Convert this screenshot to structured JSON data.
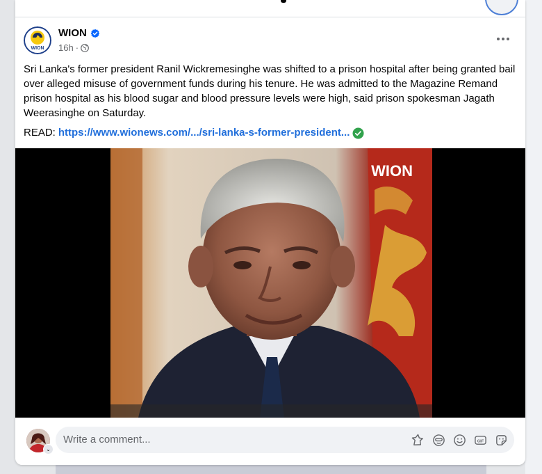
{
  "post": {
    "page_name": "WION",
    "time": "16h",
    "time_separator": "·",
    "text": "Sri Lanka's former president Ranil Wickremesinghe was shifted to a prison hospital after being granted bail over alleged misuse of government funds during his tenure. He was admitted to the Magazine Remand prison hospital as his blood sugar and blood pressure levels were high, said prison spokesman Jagath Weerasinghe on Saturday.",
    "read_label": "READ:",
    "link_text": "https://www.wionews.com/.../sri-lanka-s-former-president..."
  },
  "media": {
    "watermark": "WION",
    "avatar_logo_text": "WION"
  },
  "comment": {
    "placeholder": "Write a comment..."
  },
  "colors": {
    "link": "#216fdb",
    "verified": "#0866ff",
    "check": "#31a24c",
    "background": "#e4e6e9"
  },
  "icons": [
    "verified-badge-icon",
    "globe-icon",
    "more-options-icon",
    "check-circle-icon",
    "avatar-sticker-icon",
    "emoji-icon",
    "smiley-icon",
    "gif-icon",
    "sticker-icon"
  ]
}
